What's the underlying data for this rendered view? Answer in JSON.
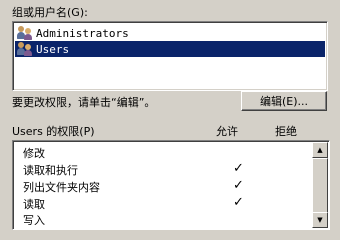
{
  "group_label": "组或用户名(G):",
  "users": [
    {
      "name": "Administrators",
      "selected": false
    },
    {
      "name": "Users",
      "selected": true
    }
  ],
  "instruction": "要更改权限，请单击“编辑”。",
  "edit_button": "编辑(E)...",
  "permissions_header": {
    "title": "Users 的权限(P)",
    "allow": "允许",
    "deny": "拒绝"
  },
  "permissions": [
    {
      "name": "修改",
      "allow": "",
      "deny": ""
    },
    {
      "name": "读取和执行",
      "allow": "✓",
      "deny": ""
    },
    {
      "name": "列出文件夹内容",
      "allow": "✓",
      "deny": ""
    },
    {
      "name": "读取",
      "allow": "✓",
      "deny": ""
    },
    {
      "name": "写入",
      "allow": "",
      "deny": ""
    }
  ],
  "icons": {
    "user_group": "user-group-icon",
    "scroll_up": "scroll-up-arrow-icon",
    "scroll_down": "scroll-down-arrow-icon"
  }
}
